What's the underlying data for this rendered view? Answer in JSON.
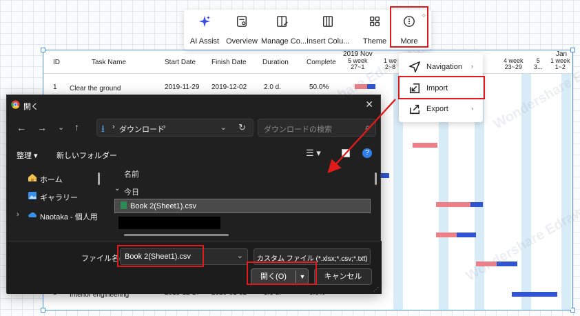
{
  "toolbar": {
    "items": [
      {
        "label": "AI Assist",
        "icon": "sparkle-icon"
      },
      {
        "label": "Overview",
        "icon": "overview-icon"
      },
      {
        "label": "Manage Co...",
        "icon": "manage-columns-icon"
      },
      {
        "label": "Insert Colu...",
        "icon": "insert-column-icon"
      },
      {
        "label": "Theme",
        "icon": "theme-icon"
      },
      {
        "label": "More",
        "icon": "more-icon"
      }
    ]
  },
  "more_menu": {
    "items": [
      {
        "label": "Navigation",
        "has_submenu": true
      },
      {
        "label": "Import",
        "has_submenu": false
      },
      {
        "label": "Export",
        "has_submenu": true
      }
    ]
  },
  "gantt": {
    "columns": [
      "ID",
      "Task Name",
      "Start Date",
      "Finish Date",
      "Duration",
      "Complete"
    ],
    "timeline": {
      "month1": "2019 Nov",
      "month2": "D",
      "month3": "Jan",
      "weeks": [
        {
          "top": "5 week",
          "bottom": "27~1"
        },
        {
          "top": "1 we",
          "bottom": "2~8"
        },
        {
          "top": "4 week",
          "bottom": "23~29"
        },
        {
          "top": "5",
          "bottom": "3..."
        },
        {
          "top": "1 week",
          "bottom": "1~2"
        }
      ]
    },
    "rows": [
      {
        "id": "1",
        "task": "Clear the ground",
        "start": "2019-11-29",
        "finish": "2019-12-02",
        "duration": "2.0 d.",
        "complete": "50.0%"
      },
      {
        "id": "8",
        "task": "Interior engineering",
        "start": "2019-12-27",
        "finish": "2020-01-02",
        "duration": "5.0 d.",
        "complete": "0.0%"
      }
    ],
    "watermark": "Wondershare EdrawMax"
  },
  "dialog": {
    "title": "開く",
    "breadcrumb_sep": "›",
    "breadcrumb": "ダウンロード",
    "search_placeholder": "ダウンロードの検索",
    "cmd_organize": "整理 ▾",
    "cmd_new_folder": "新しいフォルダー",
    "nav": [
      {
        "label": "ホーム",
        "icon": "home-icon"
      },
      {
        "label": "ギャラリー",
        "icon": "gallery-icon"
      },
      {
        "label": "Naotaka - 個人用",
        "icon": "onedrive-icon"
      }
    ],
    "column_name": "名前",
    "group_today": "今日",
    "file_item": "Book 2(Sheet1).csv",
    "filename_label": "ファイル名(N):",
    "filename_value": "Book 2(Sheet1).csv",
    "filetype_value": "カスタム ファイル (*.xlsx;*.csv;*.txt)",
    "open_button": "開く(O)",
    "cancel_button": "キャンセル"
  },
  "colors": {
    "highlight": "#e01b1b",
    "arrow": "#e01b1b",
    "bar_progress": "#ef7f87",
    "bar_remaining": "#2f55d4",
    "dialog_bg": "#202020"
  }
}
